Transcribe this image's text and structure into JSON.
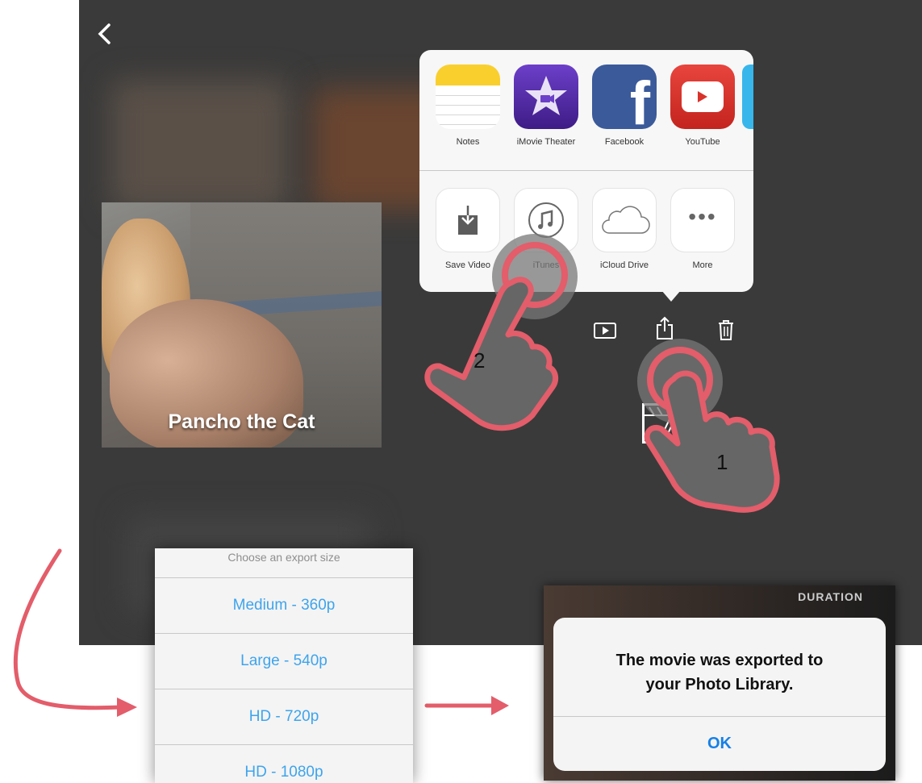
{
  "main": {
    "back_icon": "chevron-left-icon",
    "thumbnail_title": "Pancho the Cat"
  },
  "share_sheet": {
    "row1": [
      {
        "label": "Notes",
        "icon": "notes-icon"
      },
      {
        "label": "iMovie Theater",
        "icon": "imovie-theater-icon"
      },
      {
        "label": "Facebook",
        "icon": "facebook-icon"
      },
      {
        "label": "YouTube",
        "icon": "youtube-icon"
      }
    ],
    "row2": [
      {
        "label": "Save Video",
        "icon": "save-video-icon"
      },
      {
        "label": "iTunes",
        "icon": "itunes-icon"
      },
      {
        "label": "iCloud Drive",
        "icon": "icloud-drive-icon"
      },
      {
        "label": "More",
        "icon": "more-icon"
      }
    ]
  },
  "toolbar": {
    "play_icon": "play-icon",
    "share_icon": "share-icon",
    "trash_icon": "trash-icon",
    "edit_icon": "clapper-edit-icon"
  },
  "annotations": {
    "step1": "1",
    "step2": "2"
  },
  "export_sheet": {
    "header": "Choose an export size",
    "options": [
      "Medium - 360p",
      "Large - 540p",
      "HD - 720p",
      "HD - 1080p"
    ]
  },
  "alert": {
    "message_line1": "The movie was exported to",
    "message_line2": "your Photo Library.",
    "ok_label": "OK",
    "bg_duration": "DURATION"
  },
  "colors": {
    "accent_blue": "#3ea4ec",
    "ok_blue": "#1680e6",
    "annotation_red": "#e35d6a",
    "screen_bg": "#3a3a3a"
  }
}
